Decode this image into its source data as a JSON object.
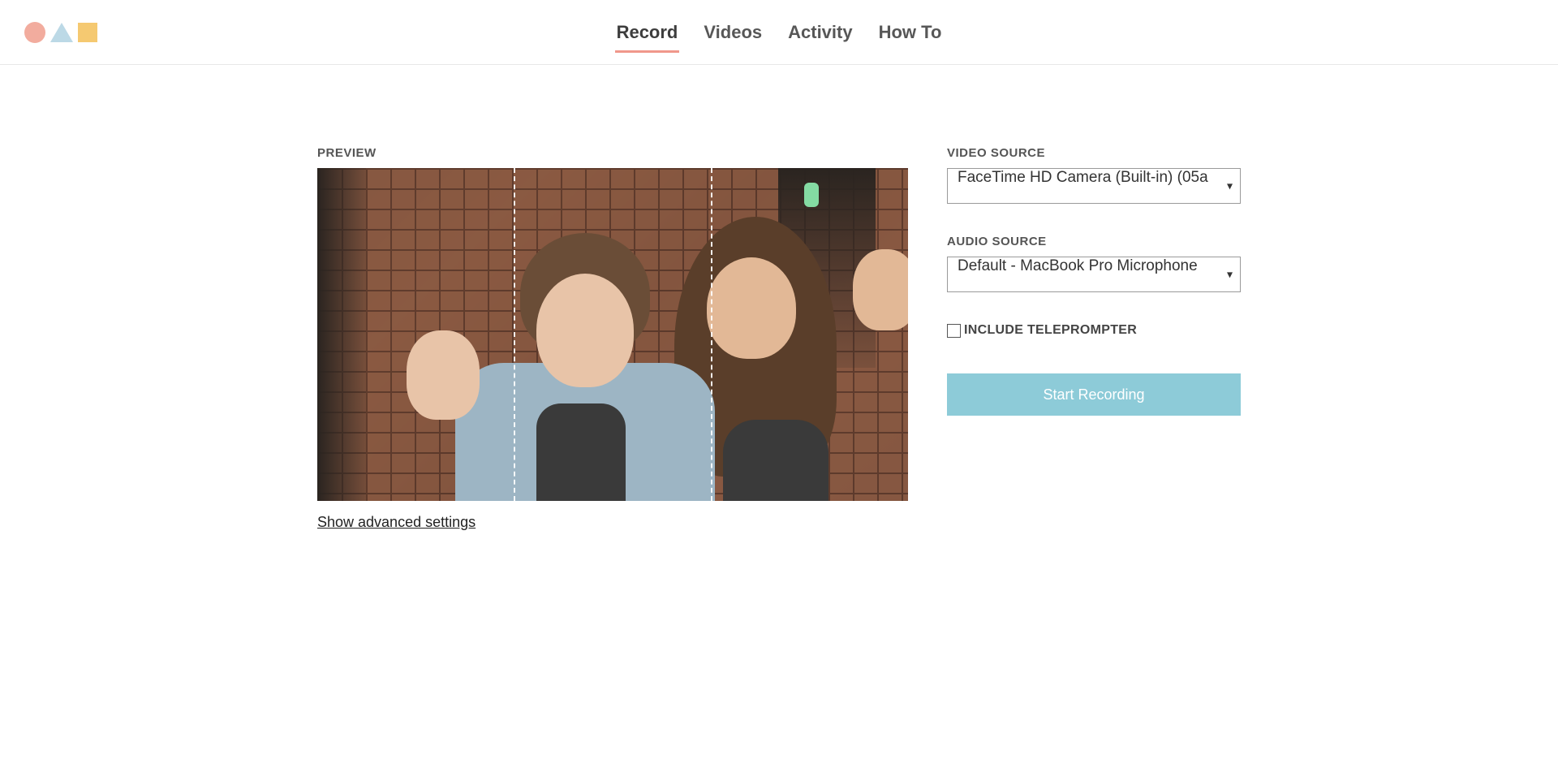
{
  "nav": {
    "items": [
      {
        "label": "Record",
        "active": true
      },
      {
        "label": "Videos",
        "active": false
      },
      {
        "label": "Activity",
        "active": false
      },
      {
        "label": "How To",
        "active": false
      }
    ]
  },
  "preview": {
    "label": "PREVIEW",
    "advanced_link": "Show advanced settings"
  },
  "settings": {
    "video_source": {
      "label": "VIDEO SOURCE",
      "selected": "FaceTime HD Camera (Built-in) (05a"
    },
    "audio_source": {
      "label": "AUDIO SOURCE",
      "selected": "Default - MacBook Pro Microphone"
    },
    "teleprompter": {
      "label": "INCLUDE TELEPROMPTER",
      "checked": false
    },
    "start_button": "Start Recording"
  }
}
